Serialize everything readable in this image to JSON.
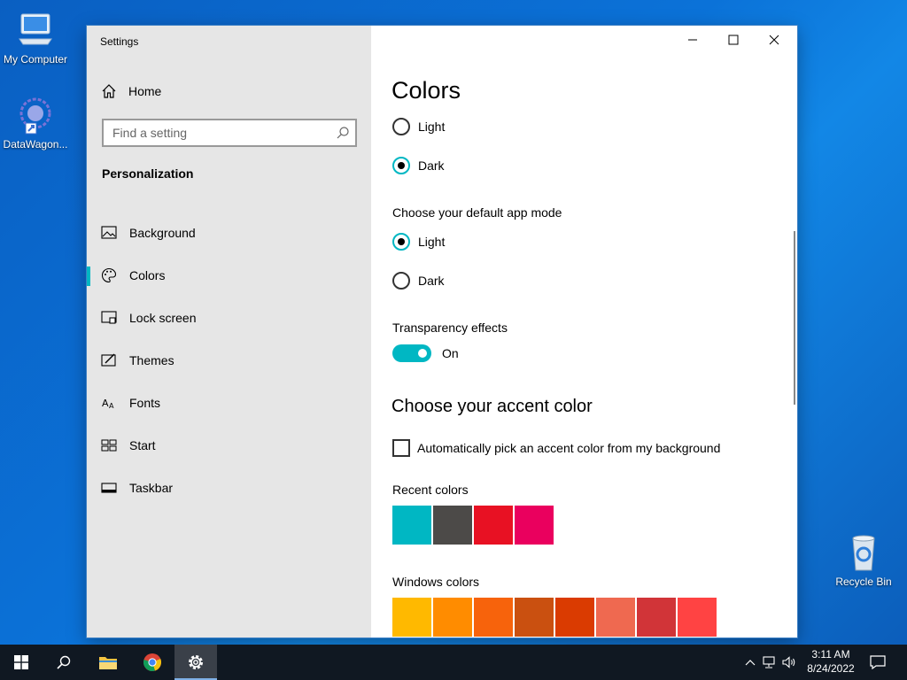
{
  "desktop": {
    "icons": [
      {
        "label": "My Computer"
      },
      {
        "label": "DataWagon..."
      },
      {
        "label": "Recycle Bin"
      }
    ]
  },
  "window": {
    "title": "Settings",
    "controls": {
      "minimize": "minimize-icon",
      "maximize": "maximize-icon",
      "close": "close-icon"
    }
  },
  "sidebar": {
    "home_label": "Home",
    "search_placeholder": "Find a setting",
    "section": "Personalization",
    "items": [
      {
        "label": "Background",
        "icon": "image-icon"
      },
      {
        "label": "Colors",
        "icon": "palette-icon",
        "active": true
      },
      {
        "label": "Lock screen",
        "icon": "lock-screen-icon"
      },
      {
        "label": "Themes",
        "icon": "themes-icon"
      },
      {
        "label": "Fonts",
        "icon": "fonts-icon"
      },
      {
        "label": "Start",
        "icon": "start-icon"
      },
      {
        "label": "Taskbar",
        "icon": "taskbar-icon"
      }
    ]
  },
  "content": {
    "title": "Colors",
    "windows_mode": {
      "options": [
        "Light",
        "Dark"
      ],
      "selected": "Dark"
    },
    "app_mode": {
      "label": "Choose your default app mode",
      "options": [
        "Light",
        "Dark"
      ],
      "selected": "Light"
    },
    "transparency": {
      "label": "Transparency effects",
      "state": "On"
    },
    "accent": {
      "heading": "Choose your accent color",
      "auto_pick_label": "Automatically pick an accent color from my background",
      "auto_pick_checked": false,
      "recent_label": "Recent colors",
      "recent_colors": [
        "#00b7c3",
        "#4c4a48",
        "#e81123",
        "#ea005e"
      ],
      "windows_label": "Windows colors",
      "windows_colors": [
        "#ffb900",
        "#ff8c00",
        "#f7630c",
        "#ca5010",
        "#da3b01",
        "#ef6950",
        "#d13438",
        "#ff4343"
      ]
    }
  },
  "taskbar": {
    "time": "3:11 AM",
    "date": "8/24/2022"
  },
  "colors": {
    "accent": "#00b7c3",
    "taskbar": "#101822",
    "sidebar": "#e6e6e6"
  }
}
